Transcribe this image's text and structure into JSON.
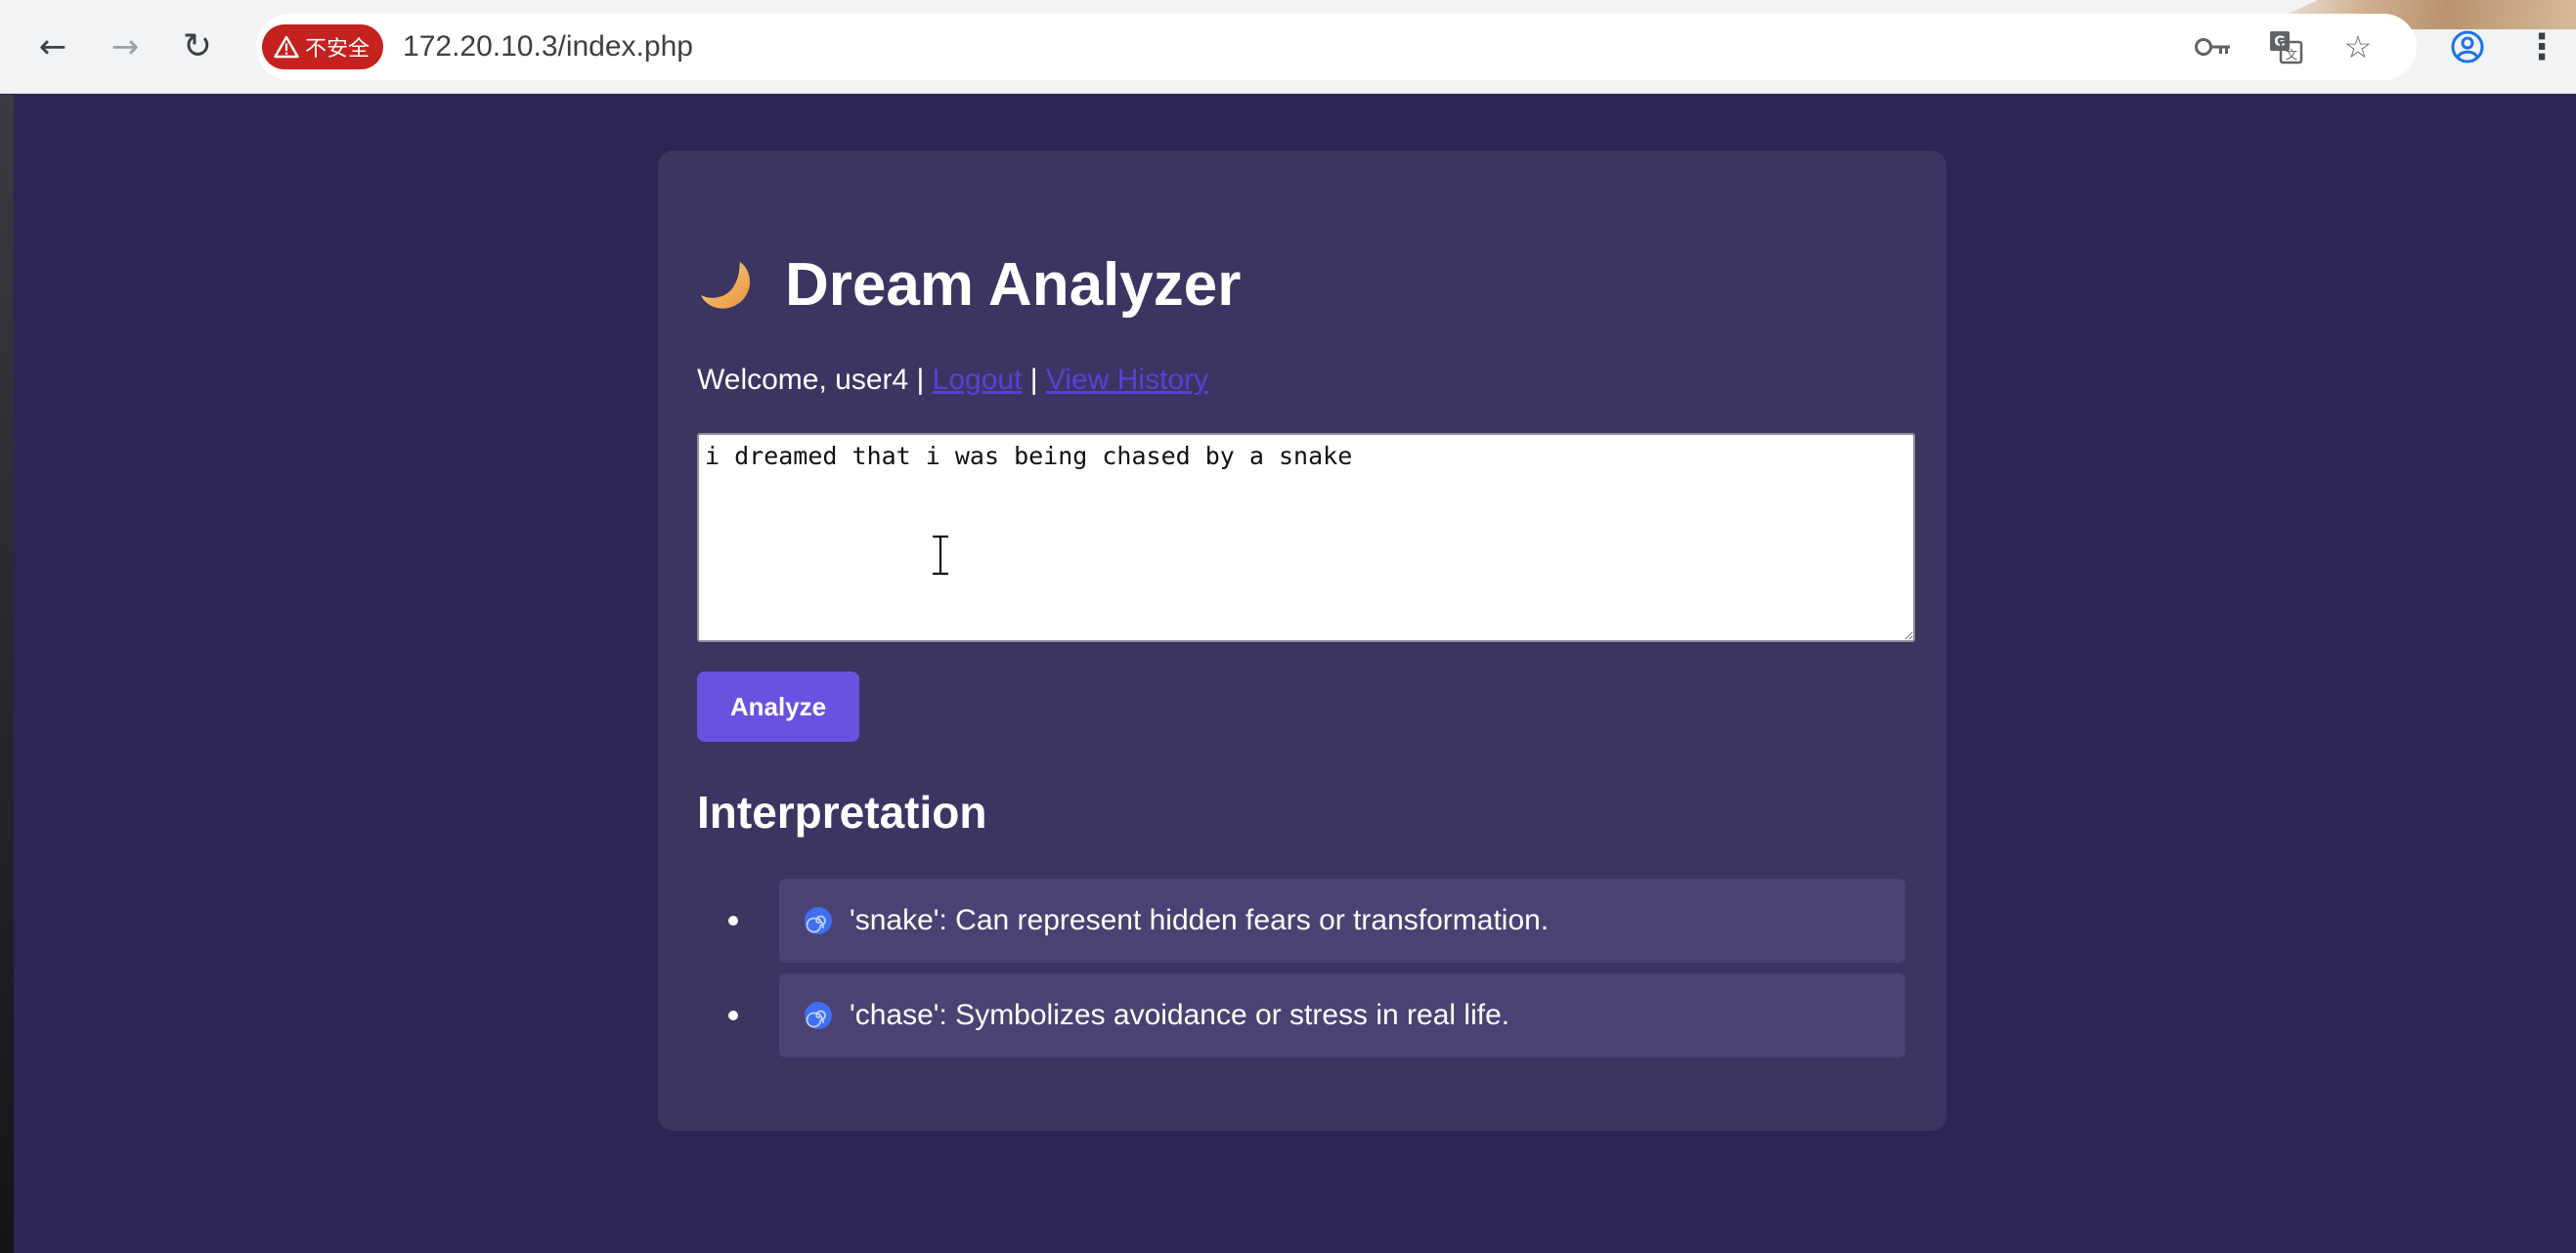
{
  "browser": {
    "security_label": "不安全",
    "url": "172.20.10.3/index.php",
    "icons": [
      "back-arrow-icon",
      "forward-arrow-icon",
      "reload-icon",
      "warning-icon",
      "key-icon",
      "translate-icon",
      "star-icon",
      "profile-icon",
      "more-vert-icon"
    ]
  },
  "page": {
    "title": "Dream Analyzer",
    "title_icon": "crescent-moon-icon",
    "welcome_text": "Welcome, user4 |",
    "logout_label": "Logout",
    "separator": "|",
    "history_label": "View History",
    "dream_input_value": "i dreamed that i was being chased by a snake",
    "analyze_label": "Analyze",
    "interpretation_heading": "Interpretation",
    "interpretations": [
      {
        "icon": "spiral-icon",
        "text": "'snake': Can represent hidden fears or transformation."
      },
      {
        "icon": "spiral-icon",
        "text": "'chase': Symbolizes avoidance or stress in real life."
      }
    ]
  },
  "colors": {
    "page_background": "#2c2654",
    "card_background": "#3b3561",
    "item_background": "#4a4273",
    "button": "#6a52e0",
    "link": "#5b3fd6",
    "security_chip": "#c5221f"
  }
}
